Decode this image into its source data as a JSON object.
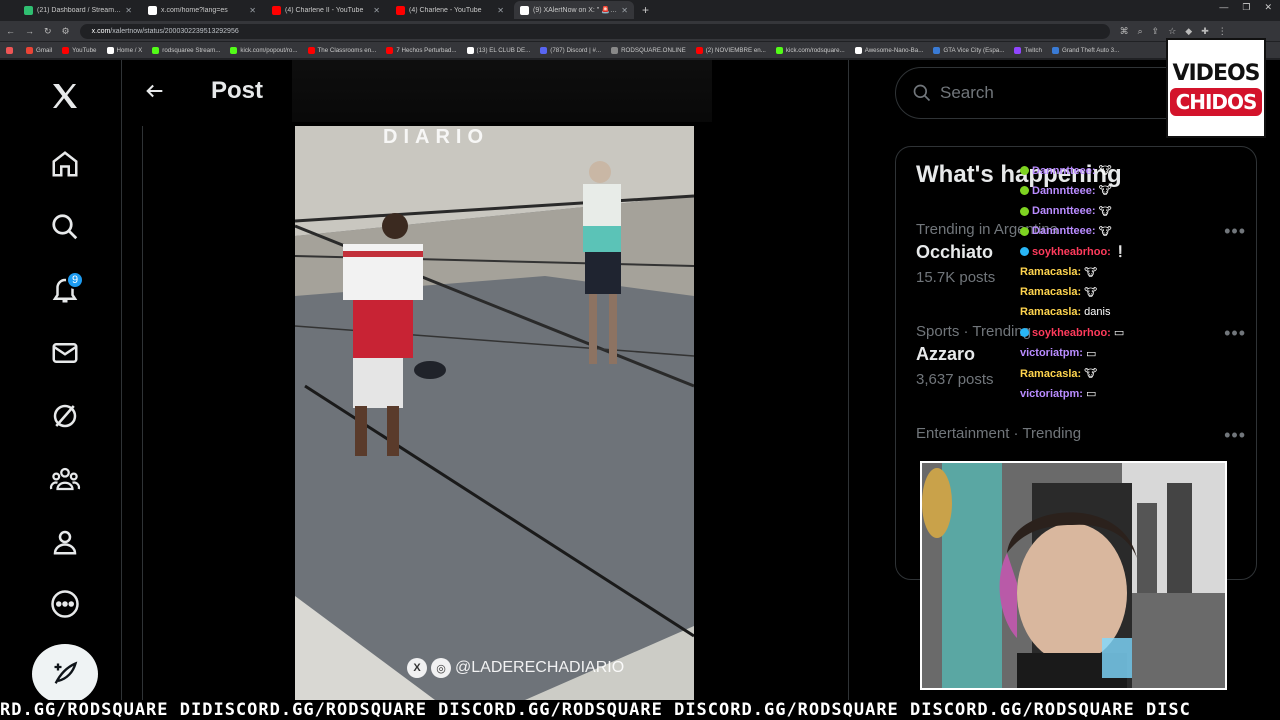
{
  "browser": {
    "tabs": [
      {
        "label": "(21) Dashboard / Streamlabs",
        "color": "#2fbf71"
      },
      {
        "label": "x.com/home?lang=es",
        "color": "#ffffff"
      },
      {
        "label": "(4) Charlene II - YouTube",
        "color": "#ff0000"
      },
      {
        "label": "(4) Charlene - YouTube",
        "color": "#ff0000"
      },
      {
        "label": "(9) XAlertNow on X: \" 🚨 BR",
        "color": "#ffffff",
        "active": true
      }
    ],
    "url_host": "x.com",
    "url_path": "/xalertnow/status/2000302239513292956",
    "bookmarks": [
      {
        "label": "",
        "color": "#e55"
      },
      {
        "label": "Gmail",
        "color": "#ea4335"
      },
      {
        "label": "YouTube",
        "color": "#ff0000"
      },
      {
        "label": "Home / X",
        "color": "#ffffff"
      },
      {
        "label": "rodsquaree Stream...",
        "color": "#53fc18"
      },
      {
        "label": "kick.com/popout/ro...",
        "color": "#53fc18"
      },
      {
        "label": "The Classrooms en...",
        "color": "#ff0000"
      },
      {
        "label": "7 Hechos Perturbad...",
        "color": "#ff0000"
      },
      {
        "label": "(13) EL CLUB DE...",
        "color": "#ffffff"
      },
      {
        "label": "(787) Discord | #...",
        "color": "#5865f2"
      },
      {
        "label": "RODSQUARE.ONLINE",
        "color": "#888"
      },
      {
        "label": "(2) NOVIEMBRE en...",
        "color": "#ff0000"
      },
      {
        "label": "kick.com/rodsquare...",
        "color": "#53fc18"
      },
      {
        "label": "Awesome-Nano-Ba...",
        "color": "#ffffff"
      },
      {
        "label": "GTA Vice City (Espa...",
        "color": "#3a7bd5"
      },
      {
        "label": "Twitch",
        "color": "#9146ff"
      },
      {
        "label": "Grand Theft Auto 3...",
        "color": "#3a7bd5"
      }
    ]
  },
  "nav": {
    "notifications_count": "9",
    "items": [
      "x-logo",
      "home",
      "explore",
      "notifications",
      "messages",
      "grok",
      "communities",
      "profile",
      "more"
    ]
  },
  "post": {
    "header_title": "Post",
    "watermark_top": "DIARIO",
    "watermark_handle": "@LADERECHADIARIO"
  },
  "sidebar": {
    "search_placeholder": "Search",
    "trends_title": "What's happening",
    "trends": [
      {
        "meta": "Trending in Argentina",
        "name": "Occhiato",
        "posts": "15.7K posts"
      },
      {
        "meta": "Sports · Trending",
        "name": "Azzaro",
        "posts": "3,637 posts"
      },
      {
        "meta": "Entertainment · Trending",
        "name": "",
        "posts": ""
      }
    ]
  },
  "chat": [
    {
      "user": "Dannntteee:",
      "color": "#b98cff",
      "dot": "#7ed321",
      "msg": "🐮"
    },
    {
      "user": "Dannntteee:",
      "color": "#b98cff",
      "dot": "#7ed321",
      "msg": "🐮"
    },
    {
      "user": "Dannntteee:",
      "color": "#b98cff",
      "dot": "#7ed321",
      "msg": "🐮"
    },
    {
      "user": "Dannntteee:",
      "color": "#b98cff",
      "dot": "#7ed321",
      "msg": "🐮"
    },
    {
      "user": "soykheabrhoo:",
      "color": "#ff3b5c",
      "dot": "#29b6f6",
      "msg": "❕"
    },
    {
      "user": "Ramacasla:",
      "color": "#ffd54f",
      "dot": "",
      "msg": "🐮"
    },
    {
      "user": "Ramacasla:",
      "color": "#ffd54f",
      "dot": "",
      "msg": "🐮"
    },
    {
      "user": "Ramacasla:",
      "color": "#ffd54f",
      "dot": "",
      "msg": "danis"
    },
    {
      "user": "soykheabrhoo:",
      "color": "#ff3b5c",
      "dot": "#29b6f6",
      "msg": "▭"
    },
    {
      "user": "victoriatpm:",
      "color": "#b98cff",
      "dot": "",
      "msg": "▭"
    },
    {
      "user": "Ramacasla:",
      "color": "#ffd54f",
      "dot": "",
      "msg": "🐮"
    },
    {
      "user": "victoriatpm:",
      "color": "#b98cff",
      "dot": "",
      "msg": "▭"
    }
  ],
  "overlay_logo": {
    "line1": "VIDEOS",
    "line2": "CHIDOS"
  },
  "ticker": "RD.GG/RODSQUARE DIDISCORD.GG/RODSQUARE DISCORD.GG/RODSQUARE DISCORD.GG/RODSQUARE DISCORD.GG/RODSQUARE DISC"
}
